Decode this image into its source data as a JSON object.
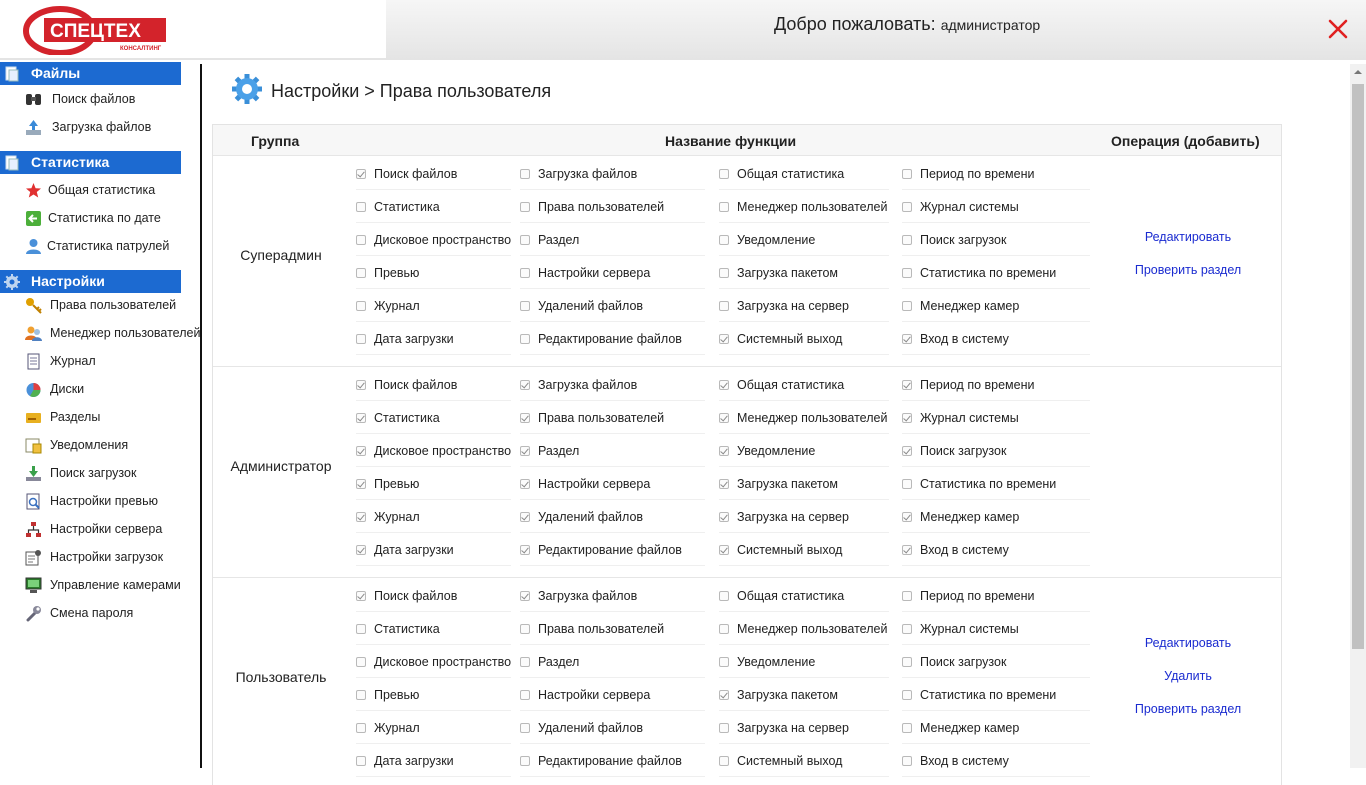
{
  "header": {
    "logo_text": "СПЕЦТЕХ",
    "logo_sub": "КОНСАЛТИНГ",
    "welcome": "Добро пожаловать:",
    "username": "администратор"
  },
  "sidebar": {
    "files": {
      "title": "Файлы",
      "items": [
        {
          "label": "Поиск файлов"
        },
        {
          "label": "Загрузка файлов"
        }
      ]
    },
    "stats": {
      "title": "Статистика",
      "items": [
        {
          "label": "Общая статистика"
        },
        {
          "label": "Статистика по дате"
        },
        {
          "label": "Статистика патрулей"
        }
      ]
    },
    "settings": {
      "title": "Настройки",
      "items": [
        {
          "label": "Права пользователей"
        },
        {
          "label": "Менеджер пользователей"
        },
        {
          "label": "Журнал"
        },
        {
          "label": "Диски"
        },
        {
          "label": "Разделы"
        },
        {
          "label": "Уведомления"
        },
        {
          "label": "Поиск загрузок"
        },
        {
          "label": "Настройки превью"
        },
        {
          "label": "Настройки сервера"
        },
        {
          "label": "Настройки загрузок"
        },
        {
          "label": "Управление камерами"
        },
        {
          "label": "Смена пароля"
        }
      ]
    }
  },
  "main": {
    "title": "Настройки > Права пользователя",
    "columns": {
      "group": "Группа",
      "function": "Название функции",
      "operation": "Операция (добавить)"
    },
    "groups": [
      {
        "name": "Суперадмин",
        "functions": [
          {
            "label": "Поиск файлов",
            "checked": true
          },
          {
            "label": "Загрузка файлов",
            "checked": false
          },
          {
            "label": "Общая статистика",
            "checked": false
          },
          {
            "label": "Период по времени",
            "checked": false
          },
          {
            "label": "Статистика",
            "checked": false
          },
          {
            "label": "Права пользователей",
            "checked": false
          },
          {
            "label": "Менеджер пользователей",
            "checked": false
          },
          {
            "label": "Журнал системы",
            "checked": false
          },
          {
            "label": "Дисковое пространство",
            "checked": false
          },
          {
            "label": "Раздел",
            "checked": false
          },
          {
            "label": "Уведомление",
            "checked": false
          },
          {
            "label": "Поиск загрузок",
            "checked": false
          },
          {
            "label": "Превью",
            "checked": false
          },
          {
            "label": "Настройки сервера",
            "checked": false
          },
          {
            "label": "Загрузка пакетом",
            "checked": false
          },
          {
            "label": "Статистика по времени",
            "checked": false
          },
          {
            "label": "Журнал",
            "checked": false
          },
          {
            "label": "Удалений файлов",
            "checked": false
          },
          {
            "label": "Загрузка на сервер",
            "checked": false
          },
          {
            "label": "Менеджер камер",
            "checked": false
          },
          {
            "label": "Дата загрузки",
            "checked": false
          },
          {
            "label": "Редактирование файлов",
            "checked": false
          },
          {
            "label": "Системный выход",
            "checked": true
          },
          {
            "label": "Вход в систему",
            "checked": true
          }
        ],
        "operations": [
          "Редактировать",
          "Проверить раздел"
        ]
      },
      {
        "name": "Администратор",
        "functions": [
          {
            "label": "Поиск файлов",
            "checked": true
          },
          {
            "label": "Загрузка файлов",
            "checked": true
          },
          {
            "label": "Общая статистика",
            "checked": true
          },
          {
            "label": "Период по времени",
            "checked": true
          },
          {
            "label": "Статистика",
            "checked": true
          },
          {
            "label": "Права пользователей",
            "checked": true
          },
          {
            "label": "Менеджер пользователей",
            "checked": true
          },
          {
            "label": "Журнал системы",
            "checked": true
          },
          {
            "label": "Дисковое пространство",
            "checked": true
          },
          {
            "label": "Раздел",
            "checked": true
          },
          {
            "label": "Уведомление",
            "checked": true
          },
          {
            "label": "Поиск загрузок",
            "checked": true
          },
          {
            "label": "Превью",
            "checked": true
          },
          {
            "label": "Настройки сервера",
            "checked": true
          },
          {
            "label": "Загрузка пакетом",
            "checked": true
          },
          {
            "label": "Статистика по времени",
            "checked": false
          },
          {
            "label": "Журнал",
            "checked": true
          },
          {
            "label": "Удалений файлов",
            "checked": true
          },
          {
            "label": "Загрузка на сервер",
            "checked": true
          },
          {
            "label": "Менеджер камер",
            "checked": true
          },
          {
            "label": "Дата загрузки",
            "checked": true
          },
          {
            "label": "Редактирование файлов",
            "checked": true
          },
          {
            "label": "Системный выход",
            "checked": true
          },
          {
            "label": "Вход в систему",
            "checked": true
          }
        ],
        "operations": []
      },
      {
        "name": "Пользователь",
        "functions": [
          {
            "label": "Поиск файлов",
            "checked": true
          },
          {
            "label": "Загрузка файлов",
            "checked": true
          },
          {
            "label": "Общая статистика",
            "checked": false
          },
          {
            "label": "Период по времени",
            "checked": false
          },
          {
            "label": "Статистика",
            "checked": false
          },
          {
            "label": "Права пользователей",
            "checked": false
          },
          {
            "label": "Менеджер пользователей",
            "checked": false
          },
          {
            "label": "Журнал системы",
            "checked": false
          },
          {
            "label": "Дисковое пространство",
            "checked": false
          },
          {
            "label": "Раздел",
            "checked": false
          },
          {
            "label": "Уведомление",
            "checked": false
          },
          {
            "label": "Поиск загрузок",
            "checked": false
          },
          {
            "label": "Превью",
            "checked": false
          },
          {
            "label": "Настройки сервера",
            "checked": false
          },
          {
            "label": "Загрузка пакетом",
            "checked": true
          },
          {
            "label": "Статистика по времени",
            "checked": false
          },
          {
            "label": "Журнал",
            "checked": false
          },
          {
            "label": "Удалений файлов",
            "checked": false
          },
          {
            "label": "Загрузка на сервер",
            "checked": false
          },
          {
            "label": "Менеджер камер",
            "checked": false
          },
          {
            "label": "Дата загрузки",
            "checked": false
          },
          {
            "label": "Редактирование файлов",
            "checked": false
          },
          {
            "label": "Системный выход",
            "checked": false
          },
          {
            "label": "Вход в систему",
            "checked": false
          }
        ],
        "operations": [
          "Редактировать",
          "Удалить",
          "Проверить раздел"
        ]
      }
    ]
  },
  "colors": {
    "accent": "#1c6ad1",
    "link": "#1a2bd0",
    "logo_red": "#d3232b",
    "close_red": "#e02020"
  }
}
